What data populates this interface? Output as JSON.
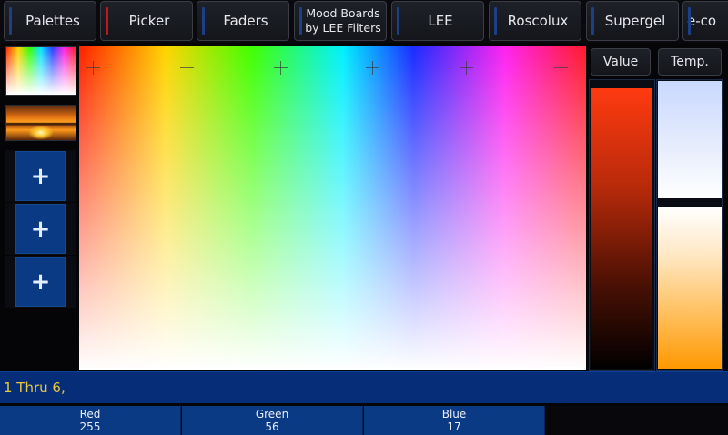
{
  "tabs": [
    {
      "label": "Palettes"
    },
    {
      "label": "Picker"
    },
    {
      "label": "Faders"
    },
    {
      "label": "Mood Boards by LEE Filters",
      "line1": "Mood Boards",
      "line2": "by LEE Filters"
    },
    {
      "label": "LEE"
    },
    {
      "label": "Roscolux"
    },
    {
      "label": "Supergel"
    },
    {
      "label": "e-co"
    }
  ],
  "active_tab": "Picker",
  "sidebar": {
    "add_buttons": [
      "+",
      "+",
      "+"
    ]
  },
  "side_buttons": {
    "value_label": "Value",
    "temp_label": "Temp."
  },
  "command_line": "1 Thru 6,",
  "rgb": {
    "red": {
      "name": "Red",
      "value": "255"
    },
    "green": {
      "name": "Green",
      "value": "56"
    },
    "blue": {
      "name": "Blue",
      "value": "17"
    }
  },
  "colors": {
    "accent_blue": "#0b3a85",
    "active_stripe": "#c01818",
    "command_text": "#e8c640"
  }
}
